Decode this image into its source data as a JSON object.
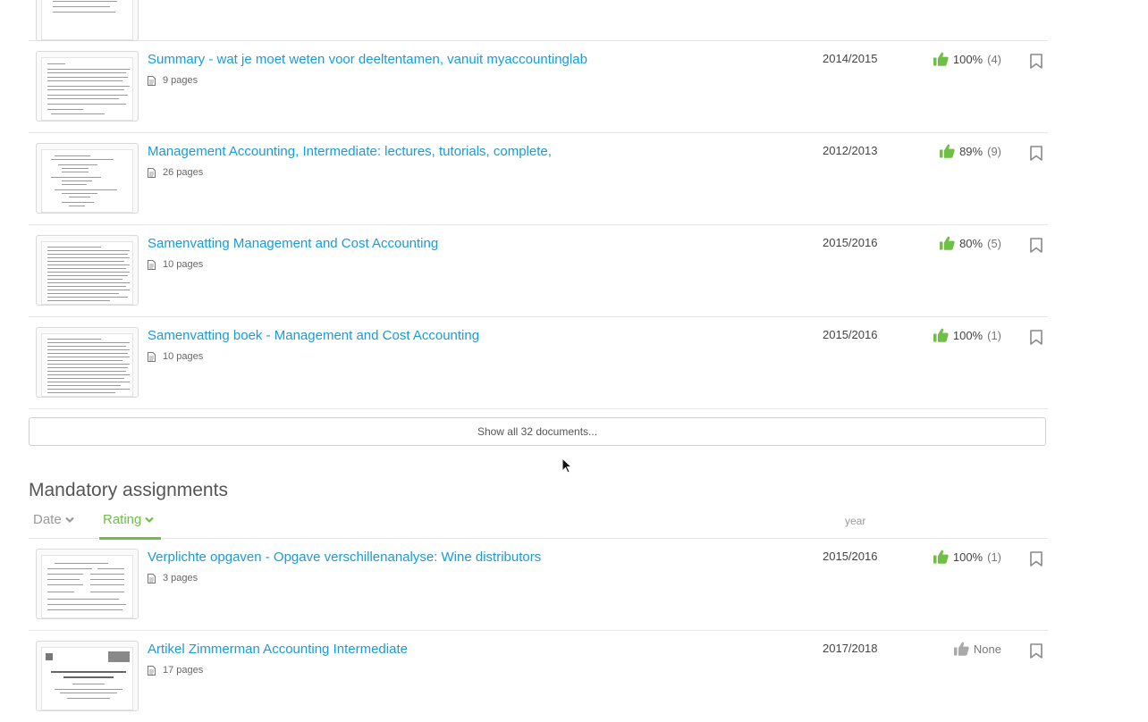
{
  "documents": [
    {
      "title": "",
      "pages": "",
      "year": "",
      "pct": "",
      "count": ""
    },
    {
      "title": "Summary - wat je moet weten voor deeltentamen, vanuit myaccountinglab",
      "pages": "9 pages",
      "year": "2014/2015",
      "pct": "100%",
      "count": "(4)"
    },
    {
      "title": "Management Accounting, Intermediate: lectures, tutorials, complete,",
      "pages": "26 pages",
      "year": "2012/2013",
      "pct": "89%",
      "count": "(9)"
    },
    {
      "title": "Samenvatting Management and Cost Accounting",
      "pages": "10 pages",
      "year": "2015/2016",
      "pct": "80%",
      "count": "(5)"
    },
    {
      "title": "Samenvatting boek - Management and Cost Accounting",
      "pages": "10 pages",
      "year": "2015/2016",
      "pct": "100%",
      "count": "(1)"
    }
  ],
  "show_all_label": "Show all 32 documents...",
  "mandatory": {
    "section_title": "Mandatory assignments",
    "sort": {
      "date_label": "Date",
      "rating_label": "Rating",
      "year_header": "year"
    },
    "items": [
      {
        "title": "Verplichte opgaven - Opgave verschillenanalyse: Wine distributors",
        "pages": "3 pages",
        "year": "2015/2016",
        "pct": "100%",
        "count": "(1)"
      },
      {
        "title": "Artikel Zimmerman Accounting Intermediate",
        "pages": "17 pages",
        "year": "2017/2018",
        "pct": "None",
        "count": ""
      }
    ]
  },
  "colors": {
    "link": "#1a9bd7",
    "accent_green": "#6fbe45",
    "thumb_gray": "#a9a9a9"
  },
  "icons": {
    "thumb": "thumbs-up-icon",
    "bookmark": "bookmark-icon",
    "doc": "document-icon",
    "sort": "chevron-down-icon"
  }
}
